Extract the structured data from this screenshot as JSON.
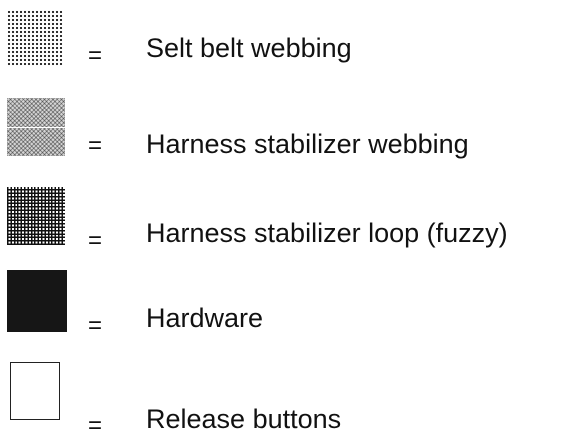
{
  "legend": {
    "items": [
      {
        "label": "Selt belt webbing",
        "separator": "=",
        "swatch": "fine-dot-pattern-icon"
      },
      {
        "label": "Harness stabilizer webbing",
        "separator": "=",
        "swatch": "stipple-pattern-icon"
      },
      {
        "label": "Harness stabilizer loop (fuzzy)",
        "separator": "=",
        "swatch": "crosshatch-pattern-icon"
      },
      {
        "label": "Hardware",
        "separator": "=",
        "swatch": "solid-black-icon",
        "color": "#161616"
      },
      {
        "label": "Release buttons",
        "separator": "=",
        "swatch": "outline-rectangle-icon"
      }
    ]
  }
}
